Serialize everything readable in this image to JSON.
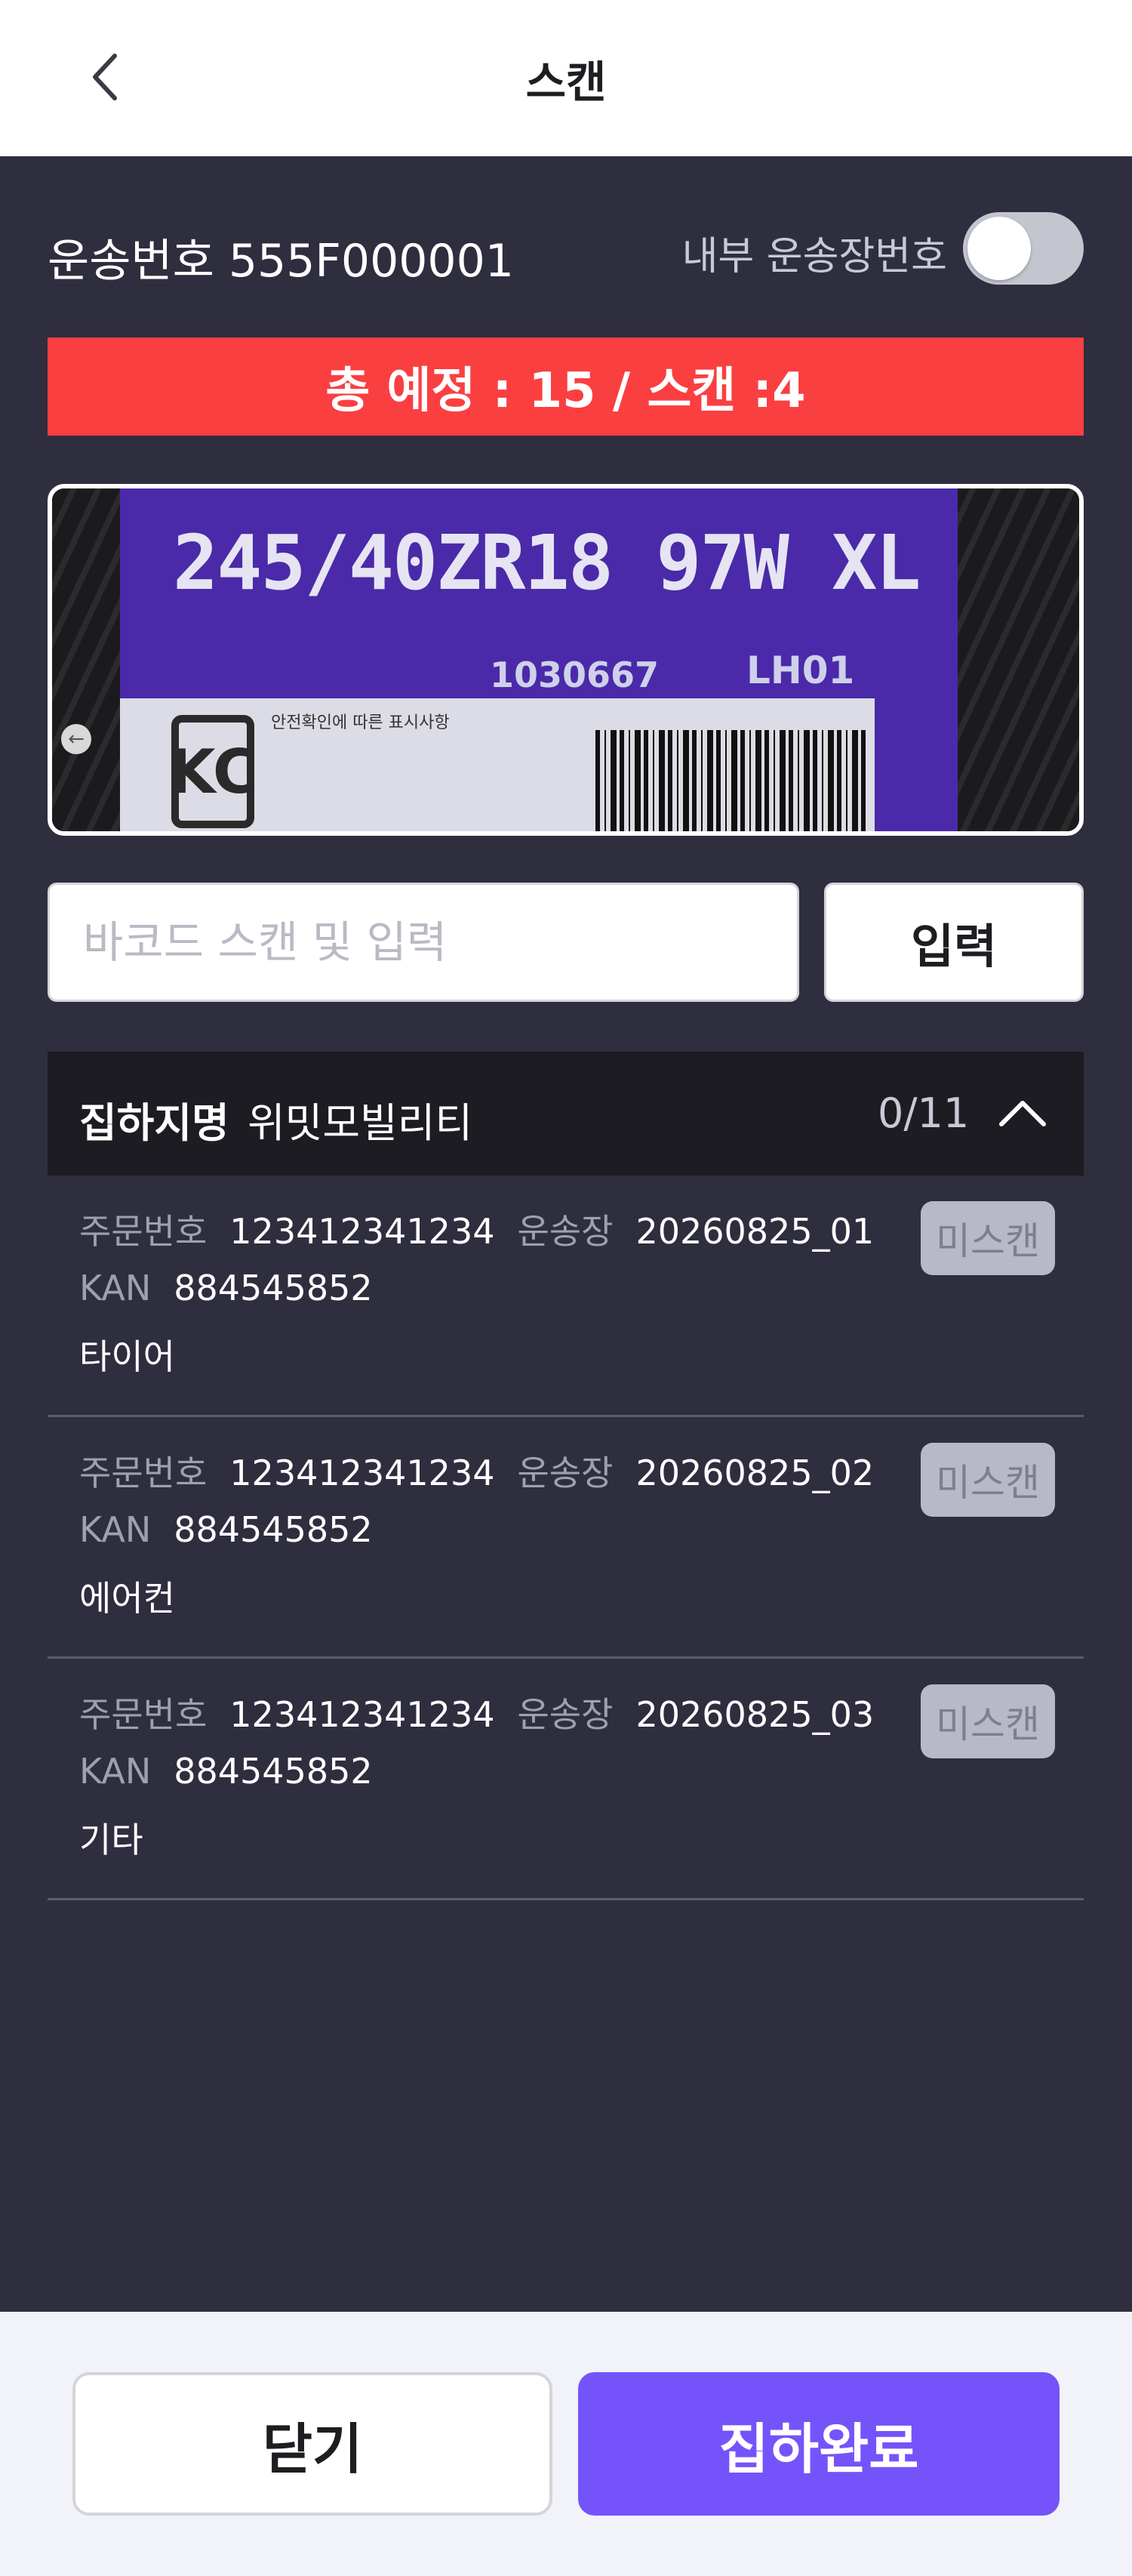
{
  "header": {
    "title": "스캔",
    "back_icon": "chevron-left-icon"
  },
  "shipment": {
    "label": "운송번호 555F000001",
    "internal_label": "내부 운송장번호",
    "internal_toggle_on": false
  },
  "summary": {
    "text": "총 예정 : 15 / 스캔 :4",
    "color": "#fa3f41"
  },
  "camera": {
    "tire_size": "245/40ZR18 97W XL",
    "code": "1030667",
    "batch": "LH01",
    "kc_mark": "KC",
    "kc_text": "안전확인에 따른 표시사항"
  },
  "barcode": {
    "placeholder": "바코드 스캔 및 입력",
    "value": "",
    "button": "입력"
  },
  "group": {
    "label": "집하지명",
    "name": "위밋모빌리티",
    "count": "0/11"
  },
  "items": [
    {
      "order_label": "주문번호",
      "order_no": "123412341234",
      "waybill_label": "운송장",
      "waybill": "20260825_01",
      "kan_label": "KAN",
      "kan": "884545852",
      "category": "타이어",
      "status": "미스캔"
    },
    {
      "order_label": "주문번호",
      "order_no": "123412341234",
      "waybill_label": "운송장",
      "waybill": "20260825_02",
      "kan_label": "KAN",
      "kan": "884545852",
      "category": "에어컨",
      "status": "미스캔"
    },
    {
      "order_label": "주문번호",
      "order_no": "123412341234",
      "waybill_label": "운송장",
      "waybill": "20260825_03",
      "kan_label": "KAN",
      "kan": "884545852",
      "category": "기타",
      "status": "미스캔"
    }
  ],
  "footer": {
    "close": "닫기",
    "complete": "집하완료",
    "accent": "#7553fa"
  }
}
